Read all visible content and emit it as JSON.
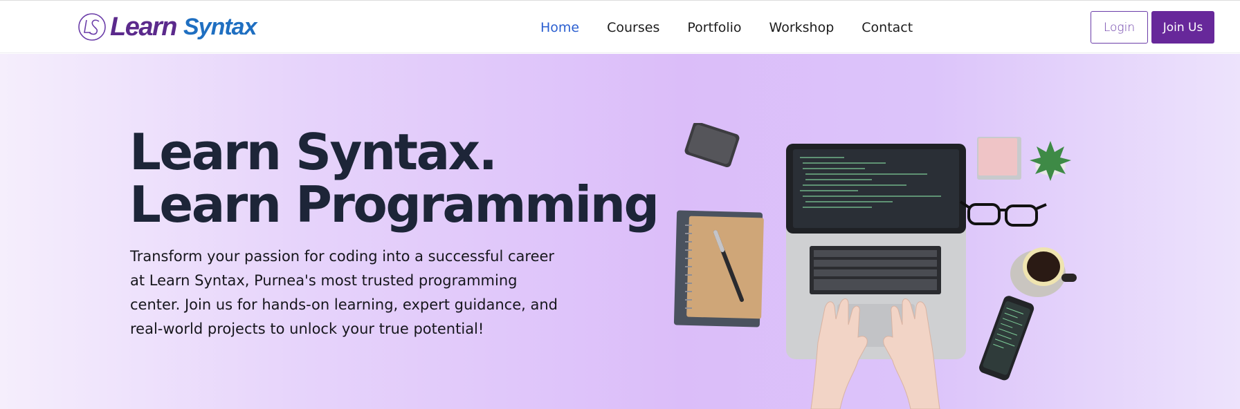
{
  "brand": {
    "mark_text": "LS",
    "word_one": "Learn",
    "word_two": "Syntax",
    "colors": {
      "primary": "#5b2a8c",
      "secondary": "#1f6fc1"
    }
  },
  "nav": {
    "items": [
      {
        "label": "Home",
        "active": true
      },
      {
        "label": "Courses",
        "active": false
      },
      {
        "label": "Portfolio",
        "active": false
      },
      {
        "label": "Workshop",
        "active": false
      },
      {
        "label": "Contact",
        "active": false
      }
    ]
  },
  "auth": {
    "login_label": "Login",
    "join_label": "Join Us"
  },
  "hero": {
    "title_line1": "Learn Syntax.",
    "title_line2": "Learn Programming",
    "description": "Transform your passion for coding into a successful career at Learn Syntax, Purnea's most trusted programming center. Join us for hands-on learning, expert guidance, and real-world projects to unlock your true potential!",
    "illustration": "desk-laptop-coding-icon"
  },
  "colors": {
    "accent": "#67289a",
    "nav_active": "#2b5fd0",
    "heading": "#1d2538"
  }
}
